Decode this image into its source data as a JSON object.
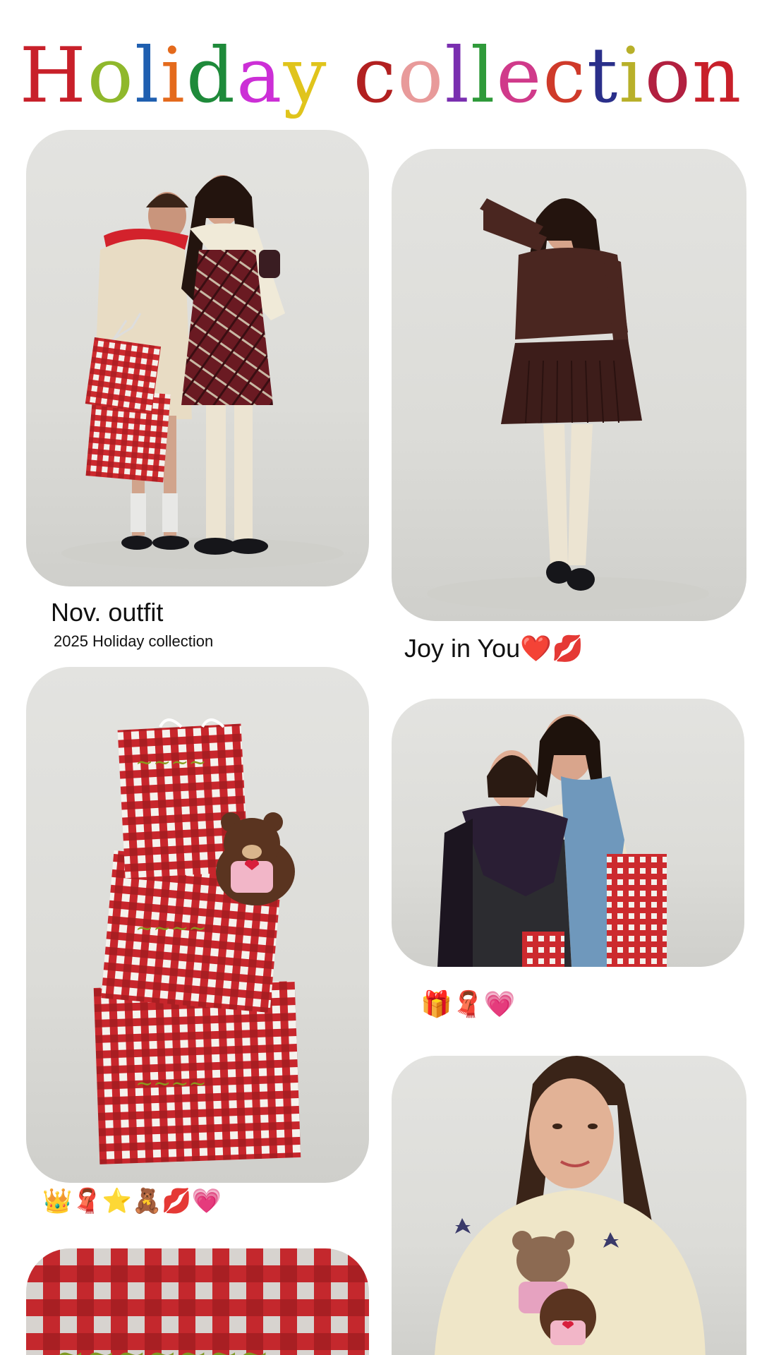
{
  "title": {
    "text": "Holiday collection",
    "letter_colors": [
      "#c8202a",
      "#8fb82c",
      "#1f5fb0",
      "#e46a1c",
      "#1e8a3a",
      "#cc2fd6",
      "#e0c41c",
      "#ffffff",
      "#b22020",
      "#e89a9a",
      "#7a2fb0",
      "#2f9a3a",
      "#d03a8a",
      "#cf3a2a",
      "#2a2f8a",
      "#b8b02a",
      "#b22040"
    ]
  },
  "posts": [
    {
      "id": "post-1",
      "caption_title": "Nov. outfit",
      "caption_subtitle": "2025 Holiday collection"
    },
    {
      "id": "post-2",
      "caption_title": "Joy in You❤️💋"
    },
    {
      "id": "post-3",
      "caption_title": "👑🧣⭐🧸💋💗"
    },
    {
      "id": "post-4",
      "caption_title": "🎁🧣💗"
    },
    {
      "id": "post-5"
    },
    {
      "id": "post-6"
    }
  ],
  "colors": {
    "card_background": "#dcdcd8",
    "gingham_red": "#cc2a2e",
    "gingham_white": "#f4f1ec"
  }
}
